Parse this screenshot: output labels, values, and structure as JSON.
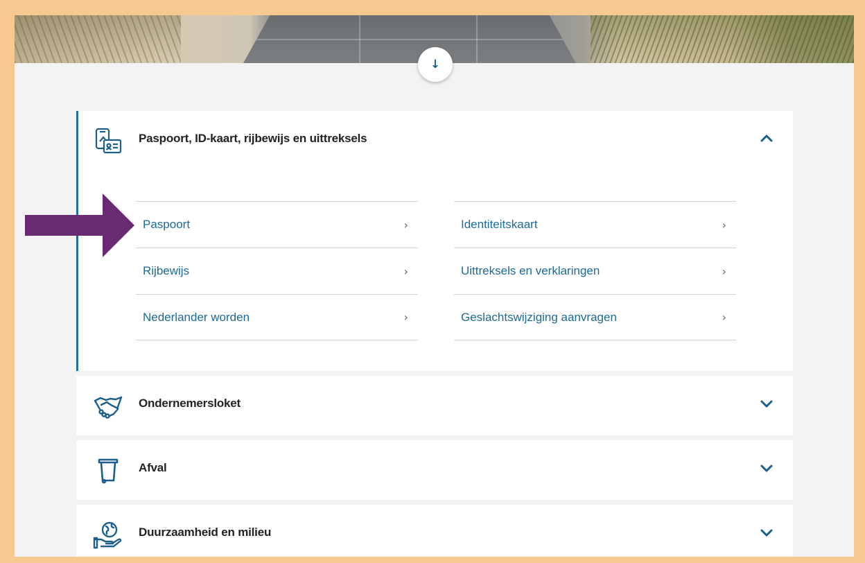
{
  "hero": {
    "scroll_icon": "arrow-down-icon",
    "scroll_glyph": "↓"
  },
  "accordion": {
    "open_panel": {
      "title": "Paspoort, ID-kaart, rijbewijs en uittreksels",
      "icon": "id-card-icon",
      "toggle_icon": "chevron-up-icon",
      "links": [
        {
          "label": "Paspoort",
          "chevron": "›"
        },
        {
          "label": "Identiteitskaart",
          "chevron": "›"
        },
        {
          "label": "Rijbewijs",
          "chevron": "›"
        },
        {
          "label": "Uittreksels en verklaringen",
          "chevron": "›"
        },
        {
          "label": "Nederlander worden",
          "chevron": "›"
        },
        {
          "label": "Geslachtswijziging aanvragen",
          "chevron": "›"
        }
      ]
    },
    "closed_panels": [
      {
        "title": "Ondernemersloket",
        "icon": "handshake-icon",
        "toggle_icon": "chevron-down-icon"
      },
      {
        "title": "Afval",
        "icon": "trash-bin-icon",
        "toggle_icon": "chevron-down-icon"
      },
      {
        "title": "Duurzaamheid en milieu",
        "icon": "globe-hand-icon",
        "toggle_icon": "chevron-down-icon"
      }
    ]
  },
  "annotation": {
    "icon": "pointer-arrow-icon",
    "color": "#6a2a73"
  },
  "colors": {
    "border": "#f5c98f",
    "accent": "#1c6ea4",
    "link": "#1c6a96",
    "background": "#f3f3f3"
  }
}
